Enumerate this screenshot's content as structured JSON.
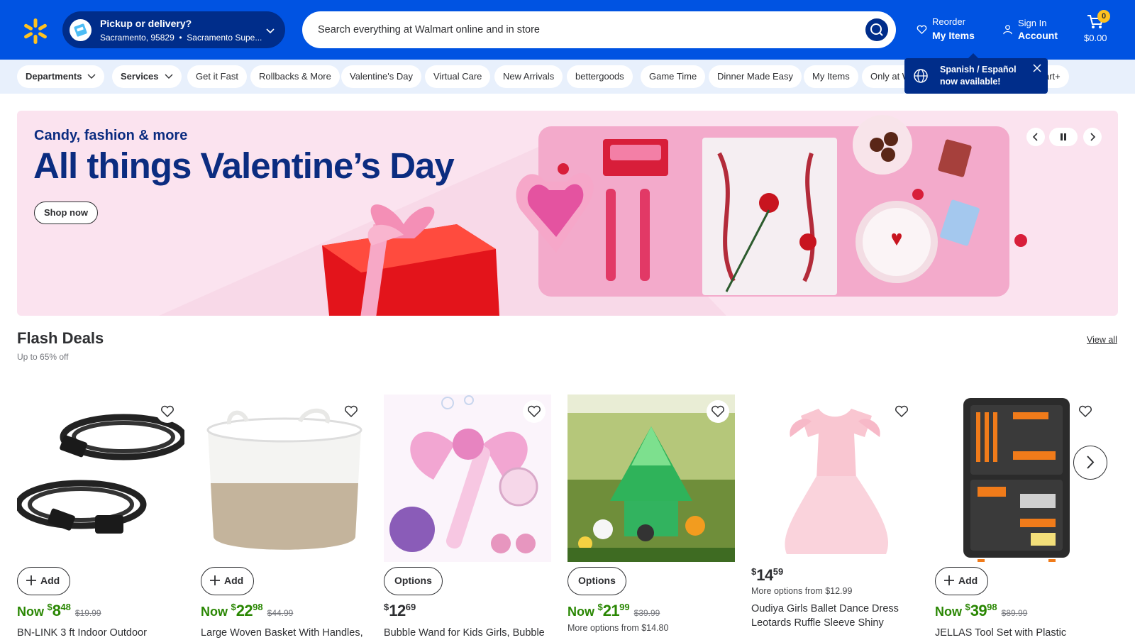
{
  "header": {
    "logo_icon": "walmart-spark-icon",
    "pickup": {
      "title": "Pickup or delivery?",
      "location": "Sacramento, 95829",
      "store": "Sacramento Supe..."
    },
    "search": {
      "placeholder": "Search everything at Walmart online and in store"
    },
    "reorder": {
      "line1": "Reorder",
      "line2": "My Items"
    },
    "account": {
      "line1": "Sign In",
      "line2": "Account"
    },
    "cart": {
      "count": "0",
      "total": "$0.00"
    }
  },
  "subnav": {
    "items": [
      "Departments",
      "Services",
      "Get it Fast",
      "Rollbacks & More",
      "Valentine's Day",
      "Virtual Care",
      "New Arrivals",
      "bettergoods",
      "Game Time",
      "Dinner Made Easy",
      "My Items",
      "Only at W",
      "art+"
    ]
  },
  "tooltip": {
    "line1": "Spanish / Español",
    "line2": "now available!"
  },
  "hero": {
    "kicker": "Candy, fashion & more",
    "title": "All things Valentine’s Day",
    "cta": "Shop now"
  },
  "flash_deals": {
    "title": "Flash Deals",
    "subtitle": "Up to 65% off",
    "view_all": "View all",
    "products": [
      {
        "button": "Add",
        "now": "Now",
        "dollars": "8",
        "cents": "48",
        "was": "$19.99",
        "name": "BN-LINK 3 ft Indoor Outdoor"
      },
      {
        "button": "Add",
        "now": "Now",
        "dollars": "22",
        "cents": "98",
        "was": "$44.99",
        "name": "Large Woven Basket With Handles,"
      },
      {
        "button": "Options",
        "dollars": "12",
        "cents": "69",
        "name": "Bubble Wand for Kids Girls, Bubble"
      },
      {
        "button": "Options",
        "now": "Now",
        "dollars": "21",
        "cents": "99",
        "was": "$39.99",
        "more": "More options from $14.80"
      },
      {
        "dollars": "14",
        "cents": "59",
        "more": "More options from $12.99",
        "name": "Oudiya Girls Ballet Dance Dress Leotards Ruffle Sleeve Shiny Ballet..."
      },
      {
        "button": "Add",
        "now": "Now",
        "dollars": "39",
        "cents": "98",
        "was": "$89.99",
        "name": "JELLAS Tool Set with Plastic"
      }
    ]
  },
  "colors": {
    "header_blue": "#0053e2",
    "navy": "#002d8a",
    "spark_yellow": "#ffc220",
    "price_green": "#2a8703",
    "hero_pink": "#fbe3ef",
    "subnav_bg": "#e8f0fc"
  }
}
